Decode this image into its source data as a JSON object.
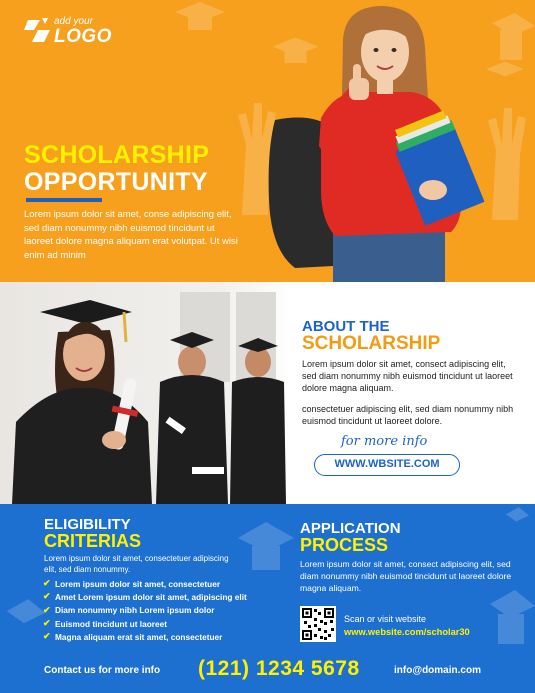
{
  "logo": {
    "small": "add your",
    "big": "LOGO"
  },
  "hero": {
    "title_line1": "SCHOLARSHIP",
    "title_line2": "OPPORTUNITY",
    "text": "Lorem ipsum dolor sit amet, conse adipiscing elit, sed diam nonummy nibh euismod tincidunt ut laoreet dolore magna aliquam erat volutpat. Ut wisi enim ad minim"
  },
  "about": {
    "title_line1": "ABOUT THE",
    "title_line2": "SCHOLARSHIP",
    "para1": "Lorem ipsum dolor sit amet, consect adipiscing elit, sed diam nonummy nibh euismod tincidunt ut laoreet dolore magna aliquam.",
    "para2": "consectetuer adipiscing elit, sed diam nonummy nibh euismod tincidunt ut laoreet dolore.",
    "more_info": "for more info",
    "website": "WWW.WBSITE.COM"
  },
  "eligibility": {
    "title_line1": "ELIGIBILITY",
    "title_line2": "CRITERIAS",
    "intro": "Lorem ipsum dolor sit amet, consectetuer adipiscing elit, sed diam nonummy.",
    "items": [
      "Lorem ipsum dolor sit amet, consectetuer",
      "Amet Lorem ipsum dolor sit amet, adipiscing elit",
      "Diam nonummy nibh Lorem ipsum dolor",
      "Euismod tincidunt ut laoreet",
      "Magna aliquam erat  sit amet, consectetuer"
    ]
  },
  "application": {
    "title_line1": "APPLICATION",
    "title_line2": "PROCESS",
    "text": "Lorem ipsum dolor sit amet, consect adipiscing elit, sed diam nonummy nibh euismod tincidunt ut laoreet dolore magna aliquam.",
    "scan_label": "Scan or visit website",
    "scan_url": "www.website.com/scholar30"
  },
  "footer": {
    "contact_label": "Contact us for more info",
    "phone": "(121) 1234 5678",
    "email": "info@domain.com"
  },
  "colors": {
    "orange": "#f6a01d",
    "blue": "#1d6fd0",
    "yellow": "#fff200"
  }
}
